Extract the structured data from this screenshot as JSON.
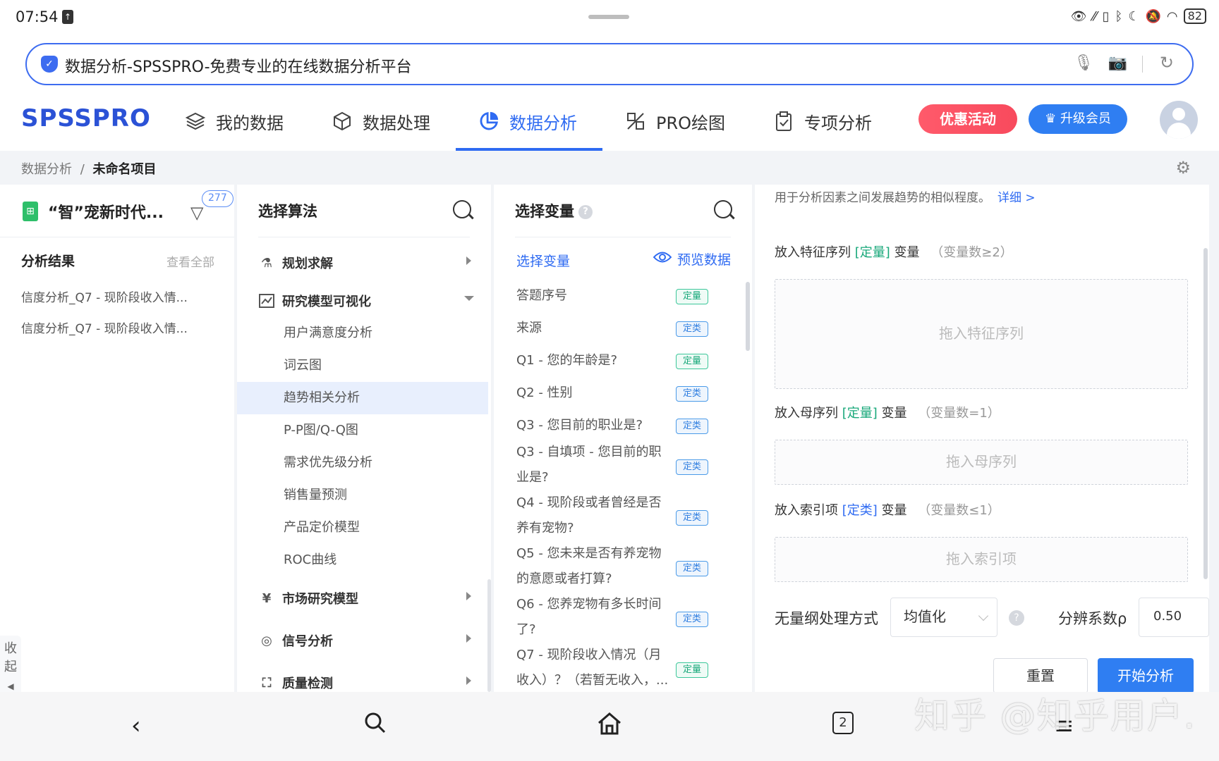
{
  "status": {
    "time": "07:54",
    "battery": "82"
  },
  "browser": {
    "url_title": "数据分析-SPSSPRO-免费专业的在线数据分析平台"
  },
  "header": {
    "logo": "SPSSPRO",
    "nav": [
      {
        "label": "我的数据",
        "icon": "layers-icon"
      },
      {
        "label": "数据处理",
        "icon": "cube-icon"
      },
      {
        "label": "数据分析",
        "icon": "pie-chart-icon",
        "active": true
      },
      {
        "label": "PRO绘图",
        "icon": "drawing-icon"
      },
      {
        "label": "专项分析",
        "icon": "clipboard-check-icon"
      }
    ],
    "promo": "优惠活动",
    "vip": "升级会员",
    "accent": "#2f6bf2"
  },
  "breadcrumb": {
    "parent": "数据分析",
    "separator": "/",
    "current": "未命名项目"
  },
  "left_panel": {
    "project_name": "“智”宠新时代...",
    "filter_badge": "277",
    "results_title": "分析结果",
    "view_all": "查看全部",
    "results": [
      "信度分析_Q7 - 现阶段收入情...",
      "信度分析_Q7 - 现阶段收入情..."
    ],
    "collapse_label": "收起"
  },
  "algorithm_panel": {
    "title": "选择算法",
    "groups": [
      {
        "label": "规划求解"
      },
      {
        "label": "研究模型可视化"
      },
      {
        "label": "市场研究模型"
      },
      {
        "label": "信号分析"
      },
      {
        "label": "质量检测"
      }
    ],
    "items": [
      "用户满意度分析",
      "词云图",
      "趋势相关分析",
      "P-P图/Q-Q图",
      "需求优先级分析",
      "销售量预测",
      "产品定价模型",
      "ROC曲线"
    ],
    "selected": "趋势相关分析"
  },
  "variable_panel": {
    "title": "选择变量",
    "select_link": "选择变量",
    "preview": "预览数据",
    "variables": [
      {
        "line1": "答题序号",
        "line2": "",
        "tag": "定量"
      },
      {
        "line1": "来源",
        "line2": "",
        "tag": "定类"
      },
      {
        "line1": "Q1 - 您的年龄是?",
        "line2": "",
        "tag": "定量"
      },
      {
        "line1": "Q2 - 性别",
        "line2": "",
        "tag": "定类"
      },
      {
        "line1": "Q3 - 您目前的职业是?",
        "line2": "",
        "tag": "定类"
      },
      {
        "line1": "Q3 - 自填项 - 您目前的职",
        "line2": "业是?",
        "tag": "定类"
      },
      {
        "line1": "Q4 - 现阶段或者曾经是否",
        "line2": "养有宠物?",
        "tag": "定类"
      },
      {
        "line1": "Q5 - 您未来是否有养宠物",
        "line2": "的意愿或者打算?",
        "tag": "定类"
      },
      {
        "line1": "Q6 - 您养宠物有多长时间",
        "line2": "了?",
        "tag": "定类"
      },
      {
        "line1": "Q7 - 现阶段收入情况（月",
        "line2": "收入）？（若暂无收入，...",
        "tag": "定量"
      }
    ]
  },
  "config_panel": {
    "description": "用于分析因素之间发展趋势的相似程度。",
    "detail_link": "详细 >",
    "feature": {
      "prefix": "放入特征序列",
      "type": "[定量]",
      "suffix": "变量",
      "hint": "（变量数≥2）",
      "drop": "拖入特征序列"
    },
    "parent": {
      "prefix": "放入母序列",
      "type": "[定量]",
      "suffix": "变量",
      "hint": "（变量数=1）",
      "drop": "拖入母序列"
    },
    "index": {
      "prefix": "放入索引项",
      "type": "[定类]",
      "suffix": "变量",
      "hint": "（变量数≤1）",
      "drop": "拖入索引项"
    },
    "dimensionless_label": "无量纲处理方式",
    "dimensionless_value": "均值化",
    "resolution_label": "分辨系数ρ",
    "resolution_value": "0.50",
    "reset": "重置",
    "start": "开始分析"
  },
  "watermark": "知乎 @知乎用户."
}
